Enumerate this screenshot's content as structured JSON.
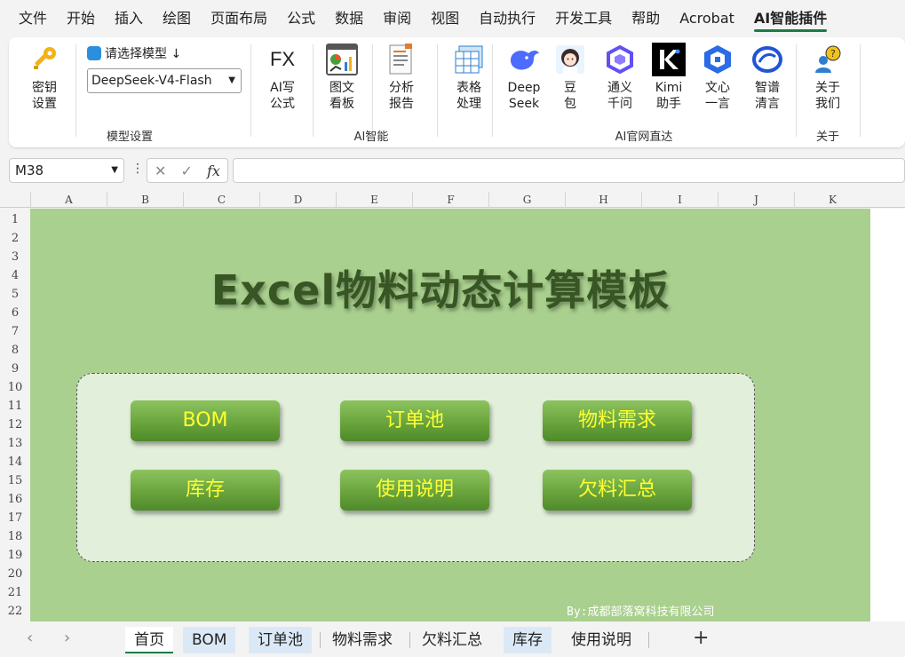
{
  "menu": [
    "文件",
    "开始",
    "插入",
    "绘图",
    "页面布局",
    "公式",
    "数据",
    "审阅",
    "视图",
    "自动执行",
    "开发工具",
    "帮助",
    "Acrobat",
    "AI智能插件"
  ],
  "ribbon": {
    "key_settings": "密钥\n设置",
    "model_label": "请选择模型 ↓",
    "model_value": "DeepSeek-V4-Flash",
    "group_model": "模型设置",
    "ai_formula": "AI写\n公式",
    "ai_formula_icon": "FX",
    "chart_board": "图文\n看板",
    "analysis": "分析\n报告",
    "table_proc": "表格\n处理",
    "group_ai": "AI智能",
    "deepseek": "Deep\nSeek",
    "doubao": "豆\n包",
    "tongyi": "通义\n千问",
    "kimi": "Kimi\n助手",
    "wenxin": "文心\n一言",
    "zhipu": "智谱\n清言",
    "group_sites": "AI官网直达",
    "about_us": "关于\n我们",
    "group_about": "关于"
  },
  "formula_bar": {
    "name_box": "M38",
    "formula": ""
  },
  "columns": [
    "A",
    "B",
    "C",
    "D",
    "E",
    "F",
    "G",
    "H",
    "I",
    "J",
    "K"
  ],
  "rows": [
    "1",
    "2",
    "3",
    "4",
    "5",
    "6",
    "7",
    "8",
    "9",
    "10",
    "11",
    "12",
    "13",
    "14",
    "15",
    "16",
    "17",
    "18",
    "19",
    "20",
    "21",
    "22"
  ],
  "sheet": {
    "title": "Excel物料动态计算模板",
    "buttons": {
      "bom": "BOM",
      "order_pool": "订单池",
      "material_demand": "物料需求",
      "inventory": "库存",
      "instructions": "使用说明",
      "shortage": "欠料汇总"
    },
    "credit": "By:成都部落窝科技有限公司"
  },
  "tabs": [
    "首页",
    "BOM",
    "订单池",
    "物料需求",
    "欠料汇总",
    "库存",
    "使用说明"
  ],
  "colors": {
    "sheet_bg": "#a9d08e",
    "panel_bg": "#e2efda",
    "title": "#375623",
    "button_text": "#ffff33",
    "accent": "#1f7a44"
  }
}
